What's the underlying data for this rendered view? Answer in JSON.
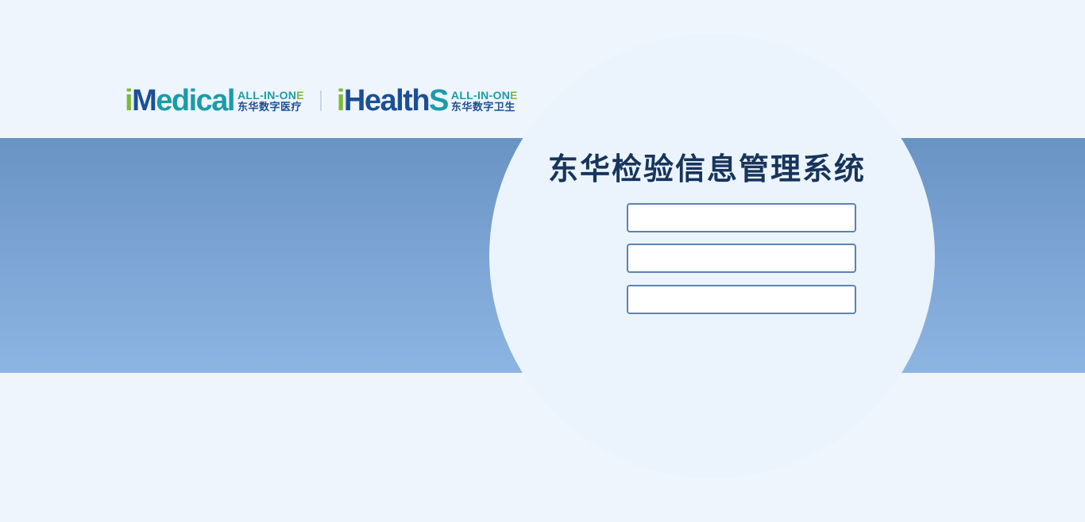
{
  "logos": {
    "imedical": {
      "word_i": "i",
      "word_m": "M",
      "word_rest": "edical",
      "tag_en": "ALL-IN-ON",
      "tag_en_last": "E",
      "tag_cn": "东华数字医疗"
    },
    "ihealths": {
      "word_i": "i",
      "word_rest": "Health",
      "word_s": "S",
      "tag_en": "ALL-IN-ON",
      "tag_en_last": "E",
      "tag_cn": "东华数字卫生"
    }
  },
  "login": {
    "title": "东华检验信息管理系统",
    "fields": [
      {
        "value": "",
        "placeholder": ""
      },
      {
        "value": "",
        "placeholder": ""
      },
      {
        "value": "",
        "placeholder": ""
      }
    ]
  },
  "colors": {
    "page_bg": "#eef5fd",
    "band_top": "#6893c3",
    "band_bottom": "#8db5e2",
    "circle": "#ebf4fc",
    "brand_blue": "#1d4f94",
    "brand_green": "#7cba35",
    "brand_teal": "#1b9ba8",
    "title": "#17345c",
    "field_border": "#5a83b6"
  }
}
